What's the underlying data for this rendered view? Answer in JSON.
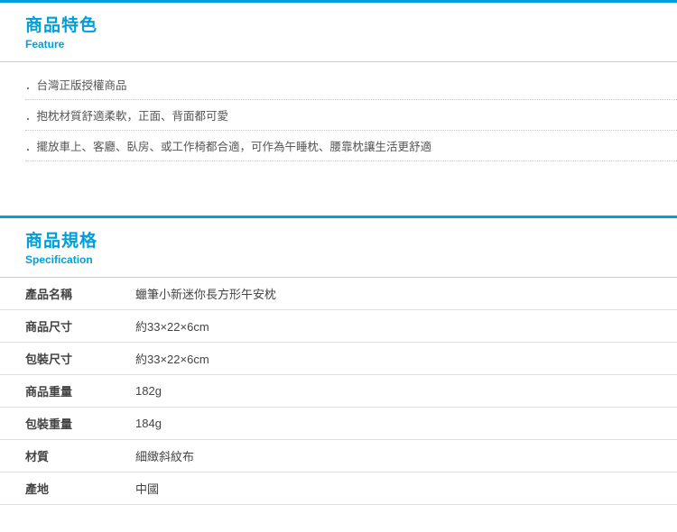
{
  "feature": {
    "title_zh": "商品特色",
    "title_en": "Feature",
    "items": [
      "．台灣正版授權商品",
      "．抱枕材質舒適柔軟，正面、背面都可愛",
      "．擺放車上、客廳、臥房、或工作椅都合適，可作為午睡枕、腰靠枕讓生活更舒適"
    ]
  },
  "spec": {
    "title_zh": "商品規格",
    "title_en": "Specification",
    "rows": [
      {
        "label": "產品名稱",
        "value": "蠟筆小新迷你長方形午安枕"
      },
      {
        "label": "商品尺寸",
        "value": "約33×22×6cm"
      },
      {
        "label": "包裝尺寸",
        "value": "約33×22×6cm"
      },
      {
        "label": "商品重量",
        "value": "182g"
      },
      {
        "label": "包裝重量",
        "value": "184g"
      },
      {
        "label": "材質",
        "value": "細緻斜紋布"
      },
      {
        "label": "產地",
        "value": "中國"
      }
    ]
  }
}
